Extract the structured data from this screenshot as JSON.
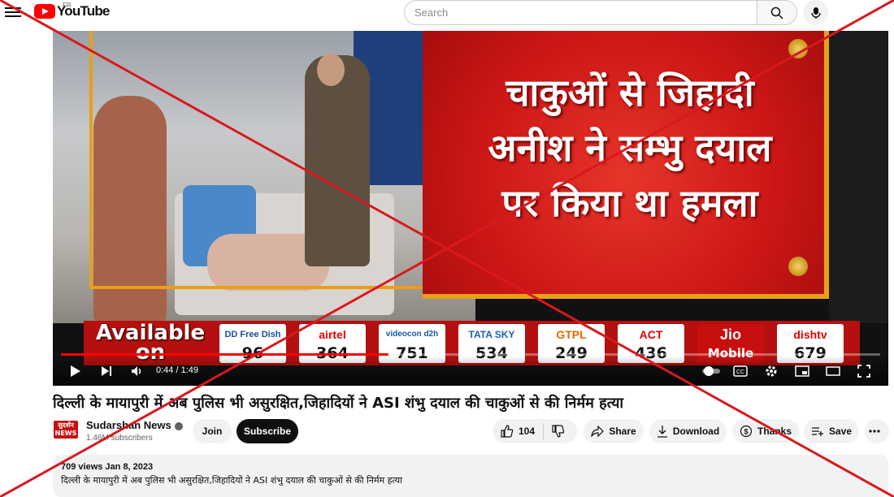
{
  "header": {
    "logo_text": "YouTube",
    "region": "FR",
    "search_placeholder": "Search",
    "icons": [
      "menu-icon",
      "search-icon",
      "mic-icon"
    ]
  },
  "video": {
    "headline_lines": [
      "चाकुओं से जिहादी",
      "अनीश ने सम्भु दयाल",
      "पर किया था हमला"
    ],
    "ticker_label": "Available on",
    "channels": [
      {
        "logo": "DD Free Dish",
        "number": "96",
        "color": "#1a4da1"
      },
      {
        "logo": "airtel",
        "number": "364",
        "color": "#e40000"
      },
      {
        "logo": "videocon d2h",
        "number": "751",
        "color": "#1a55a8"
      },
      {
        "logo": "TATA SKY",
        "number": "534",
        "color": "#1a5fb4"
      },
      {
        "logo": "GTPL",
        "number": "249",
        "color": "#e06a00"
      },
      {
        "logo": "ACT",
        "number": "436",
        "color": "#e40000"
      },
      {
        "logo": "Jio",
        "number": "Mobile",
        "color": "#c80f0f"
      },
      {
        "logo": "dishtv",
        "number": "679",
        "color": "#e40000"
      }
    ],
    "time_display": "0:44 / 1:49",
    "progress_fraction": 0.4
  },
  "title": "दिल्ली के मायापुरी में अब पुलिस भी असुरक्षित,जिहादियों ने ASI शंभु दयाल की चाकुओं से की निर्मम हत्या",
  "channel": {
    "avatar_text": "सुदर्शन NEWS",
    "name": "Sudarshan News",
    "subscribers": "1.46M subscribers",
    "join_label": "Join",
    "subscribe_label": "Subscribe"
  },
  "actions": {
    "likes": "104",
    "share_label": "Share",
    "download_label": "Download",
    "thanks_label": "Thanks",
    "save_label": "Save"
  },
  "description": {
    "meta": "709 views  Jan 8, 2023",
    "text": "दिल्ली के मायापुरी में अब पुलिस भी असुरक्षित,जिहादियों ने ASI शंभु दयाल की चाकुओं से की निर्मम हत्या"
  },
  "overlay": {
    "cross_color": "#d9181e"
  }
}
